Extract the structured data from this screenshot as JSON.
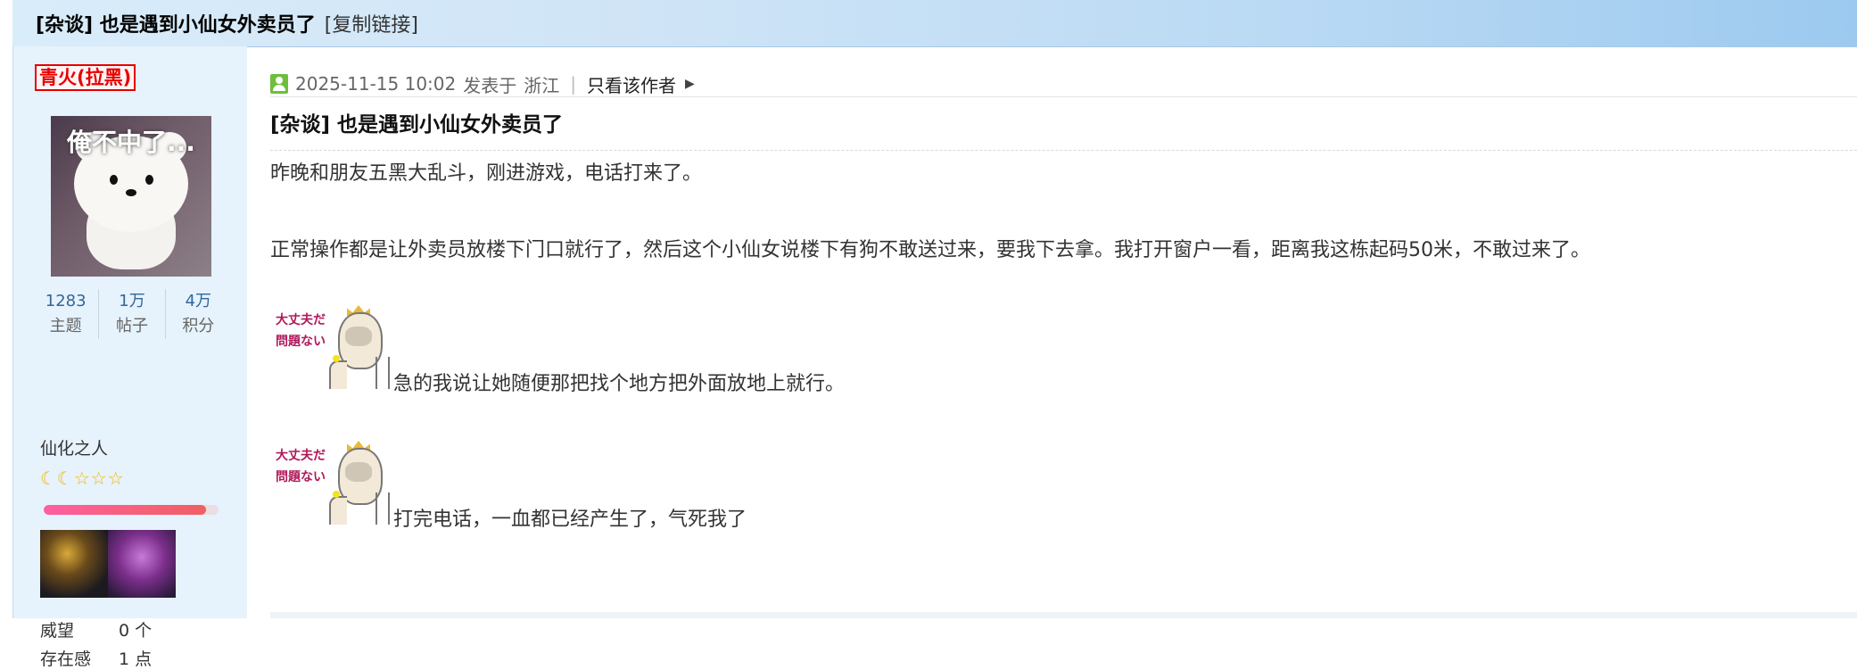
{
  "titlebar": {
    "title": "[杂谈] 也是遇到小仙女外卖员了",
    "copy_link": "[复制链接]"
  },
  "author": {
    "username": "青火(拉黑)",
    "avatar_caption": "俺不中了...",
    "stats": [
      {
        "value": "1283",
        "label": "主题"
      },
      {
        "value": "1万",
        "label": "帖子"
      },
      {
        "value": "4万",
        "label": "积分"
      }
    ],
    "rank_title": "仙化之人",
    "stars": "☾☾☆☆☆",
    "exp_fraction": 0.93,
    "attributes": [
      {
        "label": "威望",
        "value": "0 个"
      },
      {
        "label": "存在感",
        "value": "1 点"
      }
    ]
  },
  "post": {
    "datetime": "2025-11-15 10:02",
    "posted_in": "发表于",
    "location": "浙江",
    "only_author": "只看该作者",
    "title": "[杂谈] 也是遇到小仙女外卖员了",
    "paragraphs": [
      "昨晚和朋友五黑大乱斗，刚进游戏，电话打来了。",
      "正常操作都是让外卖员放楼下门口就行了，然后这个小仙女说楼下有狗不敢送过来，要我下去拿。我打开窗户一看，距离我这栋起码50米，不敢过来了。",
      "急的我说让她随便那把找个地方把外面放地上就行。",
      "打完电话，一血都已经产生了，气死我了"
    ],
    "sticker_text_line1": "大丈夫だ",
    "sticker_text_line2": "問題ない"
  },
  "colors": {
    "username_red": "#e60000",
    "link_blue": "#336699",
    "sidebar_bg": "#e6f2fc",
    "user_icon_green": "#6dbf3c"
  }
}
